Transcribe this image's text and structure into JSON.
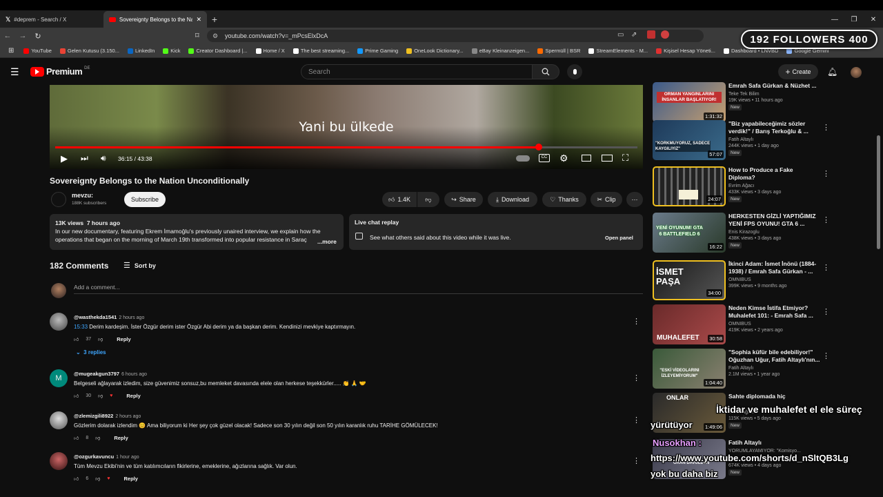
{
  "browser": {
    "tabs": [
      {
        "label": "#deprem - Search / X",
        "active": false
      },
      {
        "label": "Sovereignty Belongs to the Nati",
        "active": true
      }
    ],
    "url": "youtube.com/watch?v=_mPcsElxDcA",
    "bookmarks": [
      {
        "label": "YouTube",
        "color": "#ff0000"
      },
      {
        "label": "Gelen Kutusu (3.150...",
        "color": "#ea4335"
      },
      {
        "label": "LinkedIn",
        "color": "#0a66c2"
      },
      {
        "label": "Kick",
        "color": "#53fc18"
      },
      {
        "label": "Creator Dashboard |...",
        "color": "#53fc18"
      },
      {
        "label": "Home / X",
        "color": "#ffffff"
      },
      {
        "label": "The best streaming...",
        "color": "#ffffff"
      },
      {
        "label": "Prime Gaming",
        "color": "#1399ff"
      },
      {
        "label": "OneLook Dictionary...",
        "color": "#f0c020"
      },
      {
        "label": "eBay Kleinanzeigen...",
        "color": "#888888"
      },
      {
        "label": "Spermüll | BSR",
        "color": "#ff6a00"
      },
      {
        "label": "StreamElements - M...",
        "color": "#ffffff"
      },
      {
        "label": "Kişisel Hesap Yöneti...",
        "color": "#e03030"
      },
      {
        "label": "Dashboard • LNVBD",
        "color": "#ffffff"
      },
      {
        "label": "Google Gemini",
        "color": "#8ab4f8"
      }
    ]
  },
  "overlay": {
    "followers": "192 FOLLOWERS 400",
    "line1": "İktidar ve muhalefet el ele süreç",
    "line2": "yürütüyor",
    "line3": "Nusokhan :",
    "line4": "https://www.youtube.com/shorts/d_nSltQB3Lg",
    "line5": "yok bu daha biz"
  },
  "header": {
    "logo": "Premium",
    "logo_sup": "DE",
    "search_placeholder": "Search",
    "create_label": "Create"
  },
  "player": {
    "caption": "Yani bu ülkede",
    "time": "36:15 / 43:38",
    "progress": 0.83
  },
  "video": {
    "title": "Sovereignty Belongs to the Nation Unconditionally",
    "channel": "mevzu:",
    "subscribers": "188K subscribers",
    "subscribe_label": "Subscribe",
    "likes": "1.4K",
    "share_label": "Share",
    "download_label": "Download",
    "thanks_label": "Thanks",
    "clip_label": "Clip",
    "stats": "13K views  7 hours ago",
    "description_line1": "In our new documentary, featuring Ekrem İmamoğlu's previously unaired interview, we explain how the",
    "description_line2": "operations that began on the morning of March 19th transformed into popular resistance in Saraç",
    "more": "...more",
    "chat_title": "Live chat replay",
    "chat_text": "See what others said about this video while it was live.",
    "open_panel": "Open panel"
  },
  "comments": {
    "count_label": "182 Comments",
    "sort_label": "Sort by",
    "add_placeholder": "Add a comment...",
    "items": [
      {
        "user": "@wasthekda1541",
        "time": "2 hours ago",
        "timestamp": "15:33",
        "text": " Derim kardeşim. İster Özgür derim ister Özgür Abi derim ya da başkan derim. Kendinizi mevkiye kaptırmayın.",
        "likes": "37",
        "reply": "Reply",
        "replies": "3 replies"
      },
      {
        "user": "@mugeakgun3797",
        "time": "6 hours ago",
        "text": "Belgeseli ağlayarak izledim, size güvenimiz sonsuz,bu memleket davasında elele olan herkese teşekkürler..... 👏 🙏 🤝",
        "likes": "30",
        "reply": "Reply",
        "avatar_letter": "M"
      },
      {
        "user": "@zlemizgili8922",
        "time": "2 hours ago",
        "text": "Gözlerim dolarak izlendim 😊 Ama biliyorum ki Her şey çok güzel olacak! Sadece son 30 yılın değil son 50 yılın karanlık ruhu TARİHE GÖMÜLECEK!",
        "likes": "8",
        "reply": "Reply"
      },
      {
        "user": "@ozgurkavuncu",
        "time": "1 hour ago",
        "text": "Tüm Mevzu Ekibi'nin ve tüm katılımcıların fikirlerine, emeklerine, ağızlarına sağlık. Var olun.",
        "likes": "6",
        "reply": "Reply"
      }
    ]
  },
  "sidebar": [
    {
      "title": "Emrah Safa Gürkan & Nüzhet ...",
      "title2": "",
      "channel": "Teke Tek Bilim",
      "meta": "19K views • 11 hours ago",
      "new": "New",
      "duration": "1:31:32",
      "thumb_text": "ORMAN YANGINLARINI İNSANLAR BAŞLATIYOR!"
    },
    {
      "title": "\"Biz yapabileceğimiz sözler",
      "title2": "verdik!\" / Barış Terkoğlu & ...",
      "channel": "Fatih Altaylı",
      "meta": "244K views • 1 day ago",
      "new": "New",
      "duration": "57:07",
      "thumb_text": "\"KORKMUYORUZ, SADECE KAYGILIYIZ\""
    },
    {
      "title": "How to Produce a Fake",
      "title2": "Diploma?",
      "channel": "Evrim Ağacı",
      "meta": "433K views • 3 days ago",
      "new": "New",
      "duration": "24:07",
      "thumb_text": ""
    },
    {
      "title": "HERKESTEN GİZLİ YAPTIĞIMIZ",
      "title2": "YENİ FPS OYUNU! GTA 6 ...",
      "channel": "Enis Kirazoglu",
      "meta": "438K views • 3 days ago",
      "new": "New",
      "duration": "16:22",
      "thumb_text": "YENİ OYUNUM! GTA 6 BATTLEFIELD 6"
    },
    {
      "title": "İkinci Adam: İsmet İnönü (1884-",
      "title2": "1938) / Emrah Safa Gürkan - ...",
      "channel": "OMNIBUS",
      "meta": "399K views • 9 months ago",
      "new": "",
      "duration": "34:00",
      "thumb_text": "İSMET PAŞA"
    },
    {
      "title": "Neden Kimse İstifa Etmiyor?",
      "title2": "Muhalefet 101: - Emrah Safa ...",
      "channel": "OMNIBUS",
      "meta": "419K views • 2 years ago",
      "new": "",
      "duration": "30:58",
      "thumb_text": "MUHALEFET"
    },
    {
      "title": "\"Sophia küfür bile edebiliyor!\"",
      "title2": "Oğuzhan Uğur, Fatih Altaylı'nın...",
      "channel": "Fatih Altaylı",
      "meta": "2.1M views • 1 year ago",
      "new": "",
      "duration": "1:04:40",
      "thumb_text": "\"ESKİ VİDEOLARINI İZLEYEMİYORUM\""
    },
    {
      "title": "Sahte diplomada hiç",
      "title2": "",
      "channel": "Murat Ağırel",
      "meta": "115K views • 5 days ago",
      "new": "New",
      "duration": "1:49:06",
      "thumb_text": "ONLAR"
    },
    {
      "title": "Fatih Altaylı",
      "title2": "YORUMLAYAMIYOR: \"Komisyo...",
      "channel": "",
      "meta": "674K views • 4 days ago",
      "new": "New",
      "duration": "",
      "thumb_text": "ORAN DAVULDEN"
    }
  ]
}
